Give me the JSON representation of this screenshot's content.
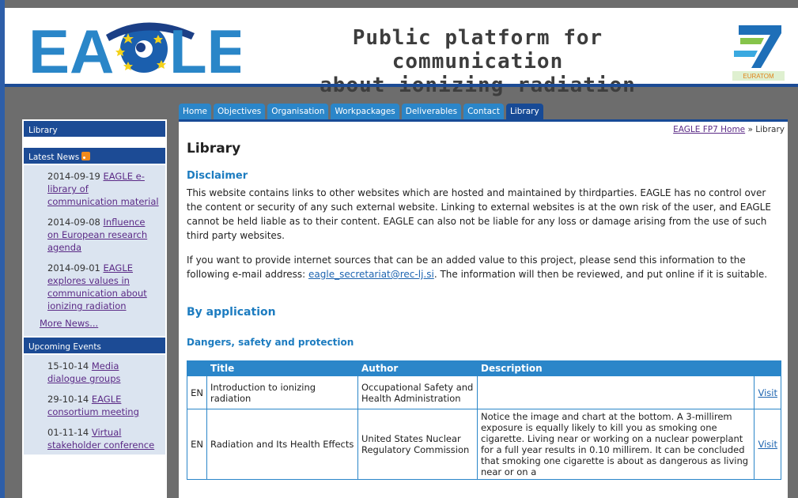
{
  "header": {
    "logo_text": "EAGLE",
    "tagline_line1": "Public platform for communication",
    "tagline_line2": "about ionizing radiation",
    "euratom_label": "EURATOM"
  },
  "nav": {
    "tabs": [
      {
        "label": "Home"
      },
      {
        "label": "Objectives"
      },
      {
        "label": "Organisation"
      },
      {
        "label": "Workpackages"
      },
      {
        "label": "Deliverables"
      },
      {
        "label": "Contact"
      },
      {
        "label": "Library",
        "active": true
      }
    ]
  },
  "sidebar": {
    "library_title": "Library",
    "news_title": "Latest News",
    "news": [
      {
        "date": "2014-09-19",
        "link": "EAGLE e-library of communication material"
      },
      {
        "date": "2014-09-08",
        "link": "Influence on European research agenda"
      },
      {
        "date": "2014-09-01",
        "link": "EAGLE explores values in communication about ionizing radiation"
      }
    ],
    "more_news": "More News...",
    "events_title": "Upcoming Events",
    "events": [
      {
        "date": "15-10-14",
        "link": "Media dialogue groups"
      },
      {
        "date": "29-10-14",
        "link": "EAGLE consortium meeting"
      },
      {
        "date": "01-11-14",
        "link": "Virtual stakeholder conference"
      }
    ]
  },
  "content": {
    "breadcrumb_home": "EAGLE FP7 Home",
    "breadcrumb_sep": "»",
    "breadcrumb_current": "Library",
    "title": "Library",
    "disclaimer_heading": "Disclaimer",
    "disclaimer_text": "This website contains links to other websites which are hosted and maintained by thirdparties. EAGLE has no control over the content or security of any such external website. Linking to external websites is at the own risk of the user, and EAGLE cannot be held liable as to their content. EAGLE can also not be liable for any loss or damage arising from the use of such third party websites.",
    "contact_text_before": "If you want to provide internet sources that can be an added value to this project, please send this information to the following e-mail address: ",
    "contact_email": "eagle_secretariat@rec-lj.si",
    "contact_text_after": ". The information will then be reviewed, and put online if it is suitable.",
    "by_application": "By application",
    "section_heading": "Dangers, safety and protection",
    "table": {
      "headers": {
        "title": "Title",
        "author": "Author",
        "description": "Description"
      },
      "rows": [
        {
          "lang": "EN",
          "title": "Introduction to ionizing radiation",
          "author": "Occupational Safety and Health Administration",
          "description": "",
          "visit": "Visit"
        },
        {
          "lang": "EN",
          "title": "Radiation and Its Health Effects",
          "author": "United States Nuclear Regulatory Commission",
          "description": "Notice the image and chart at the bottom. A 3-millirem exposure is equally likely to kill you as smoking one cigarette. Living near or working on a nuclear powerplant for a full year results in 0.10 millirem. It can be concluded that smoking one cigarette is about as dangerous as living near or on a",
          "visit": "Visit"
        }
      ]
    }
  },
  "colors": {
    "brand_blue": "#2b86c9",
    "dark_blue": "#174a96",
    "heading_blue": "#1d7cc0",
    "link_purple": "#5b2a86"
  }
}
